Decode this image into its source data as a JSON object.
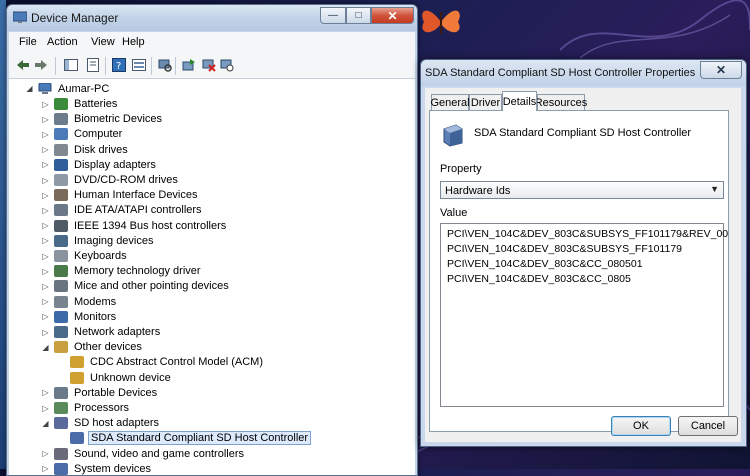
{
  "device_manager": {
    "title": "Device Manager",
    "caption_buttons": {
      "minimize": "—",
      "maximize": "□",
      "close": "✕"
    },
    "menu": [
      "File",
      "Action",
      "View",
      "Help"
    ],
    "tree": {
      "root": "Aumar-PC",
      "items": [
        {
          "label": "Batteries",
          "expander": "▷",
          "icon_color": "#3a8a3a"
        },
        {
          "label": "Biometric Devices",
          "expander": "▷",
          "icon_color": "#6c7c8c"
        },
        {
          "label": "Computer",
          "expander": "▷",
          "icon_color": "#4a7ab8"
        },
        {
          "label": "Disk drives",
          "expander": "▷",
          "icon_color": "#808890"
        },
        {
          "label": "Display adapters",
          "expander": "▷",
          "icon_color": "#2f5f9a"
        },
        {
          "label": "DVD/CD-ROM drives",
          "expander": "▷",
          "icon_color": "#909aa6"
        },
        {
          "label": "Human Interface Devices",
          "expander": "▷",
          "icon_color": "#7a6a5a"
        },
        {
          "label": "IDE ATA/ATAPI controllers",
          "expander": "▷",
          "icon_color": "#6a7888"
        },
        {
          "label": "IEEE 1394 Bus host controllers",
          "expander": "▷",
          "icon_color": "#505a66"
        },
        {
          "label": "Imaging devices",
          "expander": "▷",
          "icon_color": "#4a6a8a"
        },
        {
          "label": "Keyboards",
          "expander": "▷",
          "icon_color": "#8a949e"
        },
        {
          "label": "Memory technology driver",
          "expander": "▷",
          "icon_color": "#4a7a4a"
        },
        {
          "label": "Mice and other pointing devices",
          "expander": "▷",
          "icon_color": "#6a7480"
        },
        {
          "label": "Modems",
          "expander": "▷",
          "icon_color": "#7a848e"
        },
        {
          "label": "Monitors",
          "expander": "▷",
          "icon_color": "#3a6aa8"
        },
        {
          "label": "Network adapters",
          "expander": "▷",
          "icon_color": "#4a6a8a"
        },
        {
          "label": "Other devices",
          "expander": "◢",
          "icon_color": "#c8a040"
        },
        {
          "label": "CDC Abstract Control Model (ACM)",
          "child": true,
          "icon_color": "#d0a030"
        },
        {
          "label": "Unknown device",
          "child": true,
          "icon_color": "#d0a030"
        },
        {
          "label": "Portable Devices",
          "expander": "▷",
          "icon_color": "#6a7a8a"
        },
        {
          "label": "Processors",
          "expander": "▷",
          "icon_color": "#5a8a5a"
        },
        {
          "label": "SD host adapters",
          "expander": "◢",
          "icon_color": "#5a6a9a"
        },
        {
          "label": "SDA Standard Compliant SD Host Controller",
          "child": true,
          "selected": true,
          "icon_color": "#4a6aa8"
        },
        {
          "label": "Sound, video and game controllers",
          "expander": "▷",
          "icon_color": "#6a6a7a"
        },
        {
          "label": "System devices",
          "expander": "▷",
          "icon_color": "#4a6aa8"
        }
      ]
    }
  },
  "properties": {
    "title": "SDA Standard Compliant SD Host Controller Properties",
    "close": "✕",
    "tabs": [
      "General",
      "Driver",
      "Details",
      "Resources"
    ],
    "active_tab": "Details",
    "device_name": "SDA Standard Compliant SD Host Controller",
    "property_label": "Property",
    "property_value": "Hardware Ids",
    "value_label": "Value",
    "values": [
      "PCI\\VEN_104C&DEV_803C&SUBSYS_FF101179&REV_00",
      "PCI\\VEN_104C&DEV_803C&SUBSYS_FF101179",
      "PCI\\VEN_104C&DEV_803C&CC_080501",
      "PCI\\VEN_104C&DEV_803C&CC_0805"
    ],
    "ok_label": "OK",
    "cancel_label": "Cancel"
  }
}
